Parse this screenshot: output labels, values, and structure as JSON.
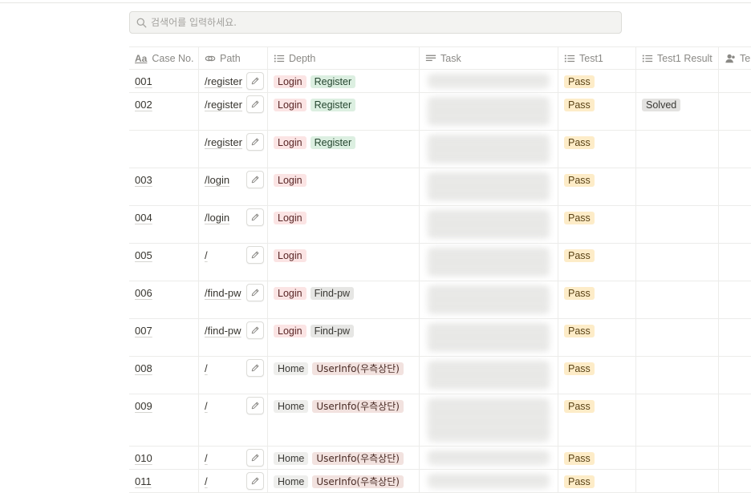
{
  "search": {
    "placeholder": "검색어를 입력하세요."
  },
  "columns": [
    {
      "label": "Case No.",
      "icon": "title-aa-icon"
    },
    {
      "label": "Path",
      "icon": "link-icon"
    },
    {
      "label": "Depth",
      "icon": "list-icon"
    },
    {
      "label": "Task",
      "icon": "text-lines-icon"
    },
    {
      "label": "Test1",
      "icon": "list-icon"
    },
    {
      "label": "Test1 Result",
      "icon": "list-icon"
    },
    {
      "label": "Te",
      "icon": "person-icon"
    }
  ],
  "rows": [
    {
      "case_no": "001",
      "path": "/register",
      "depth": [
        "Login",
        "Register"
      ],
      "test1": "Pass",
      "test1_result": ""
    },
    {
      "case_no": "002",
      "path": "/register",
      "depth": [
        "Login",
        "Register"
      ],
      "test1": "Pass",
      "test1_result": "Solved"
    },
    {
      "case_no": "",
      "path": "/register",
      "depth": [
        "Login",
        "Register"
      ],
      "test1": "Pass",
      "test1_result": ""
    },
    {
      "case_no": "003",
      "path": "/login",
      "depth": [
        "Login"
      ],
      "test1": "Pass",
      "test1_result": ""
    },
    {
      "case_no": "004",
      "path": "/login",
      "depth": [
        "Login"
      ],
      "test1": "Pass",
      "test1_result": ""
    },
    {
      "case_no": "005",
      "path": "/",
      "depth": [
        "Login"
      ],
      "test1": "Pass",
      "test1_result": ""
    },
    {
      "case_no": "006",
      "path": "/find-pw",
      "depth": [
        "Login",
        "Find-pw"
      ],
      "test1": "Pass",
      "test1_result": ""
    },
    {
      "case_no": "007",
      "path": "/find-pw",
      "depth": [
        "Login",
        "Find-pw"
      ],
      "test1": "Pass",
      "test1_result": ""
    },
    {
      "case_no": "008",
      "path": "/",
      "depth": [
        "Home",
        "UserInfo(우측상단)"
      ],
      "test1": "Pass",
      "test1_result": ""
    },
    {
      "case_no": "009",
      "path": "/",
      "depth": [
        "Home",
        "UserInfo(우측상단)"
      ],
      "test1": "Pass",
      "test1_result": ""
    },
    {
      "case_no": "010",
      "path": "/",
      "depth": [
        "Home",
        "UserInfo(우측상단)"
      ],
      "test1": "Pass",
      "test1_result": ""
    },
    {
      "case_no": "011",
      "path": "/",
      "depth": [
        "Home",
        "UserInfo(우측상단)"
      ],
      "test1": "Pass",
      "test1_result": ""
    }
  ],
  "tag_colors": {
    "Login": "#fbe4e4",
    "Register": "#dcefe1",
    "Find-pw": "#e6e6e4",
    "Home": "#eeeeec",
    "UserInfo(우측상단)": "#f2e2df",
    "Pass": "#fdecc8",
    "Solved": "#e3e2e0"
  }
}
